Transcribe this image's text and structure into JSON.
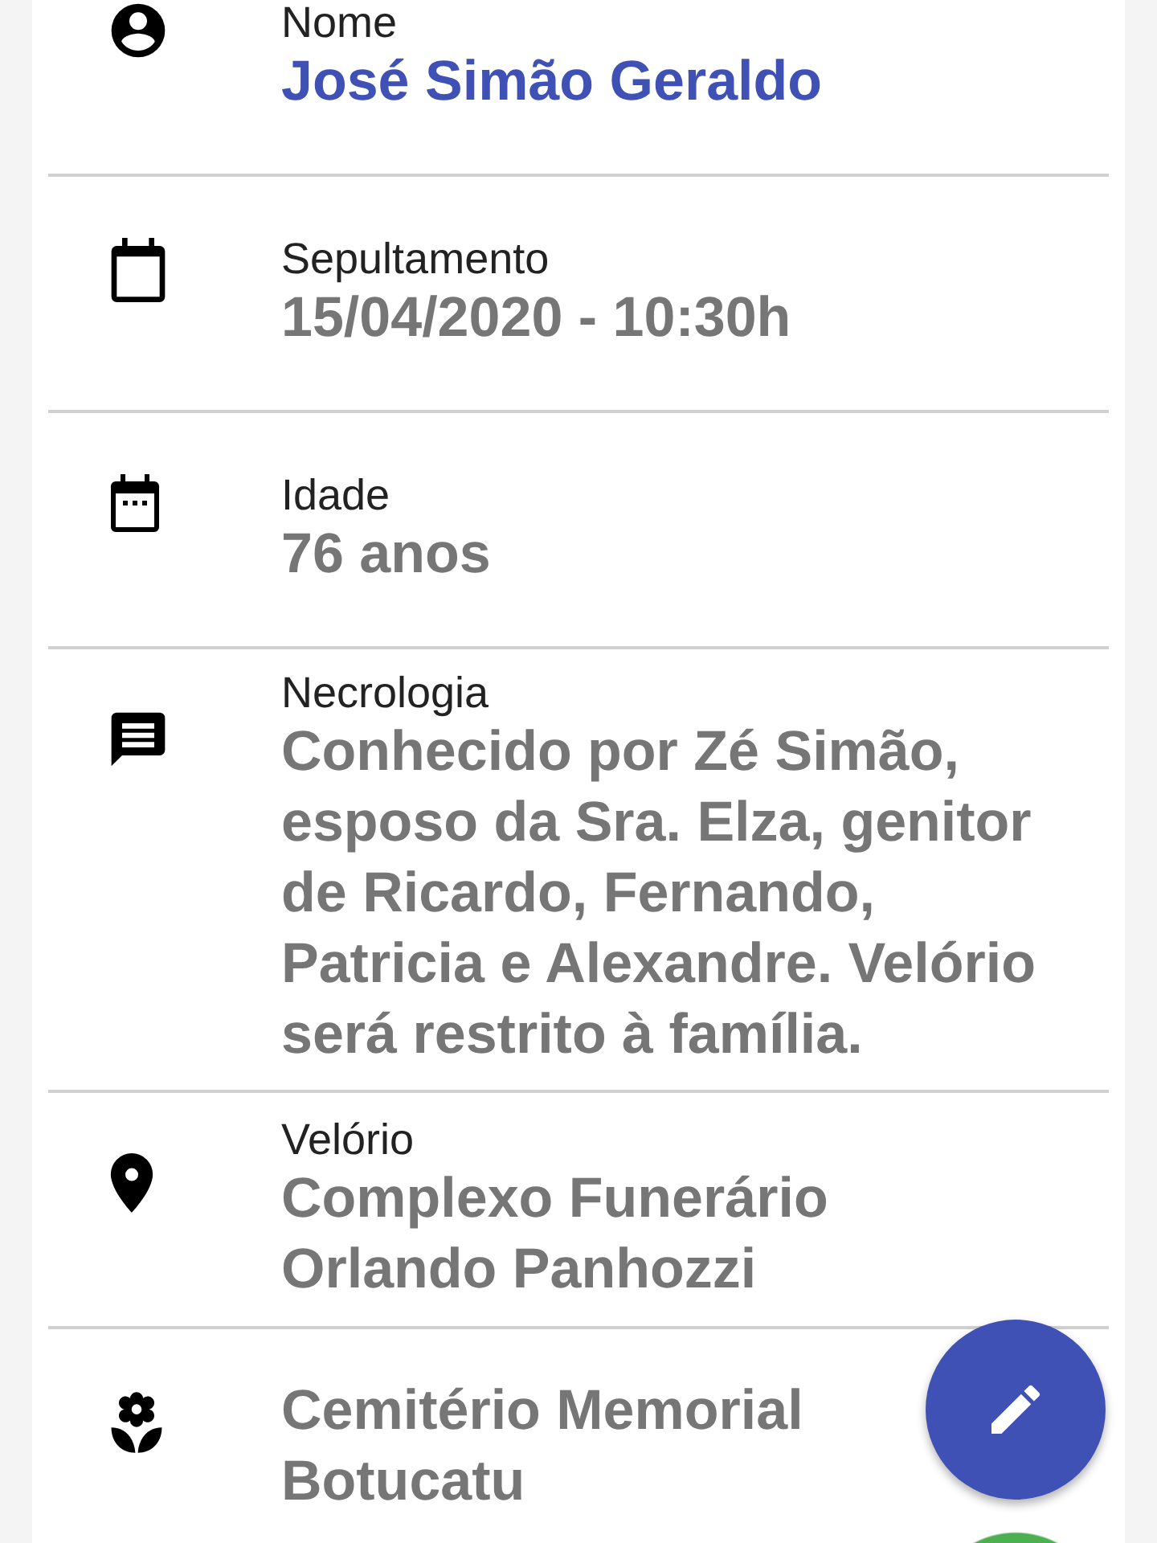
{
  "fields": [
    {
      "label": "Nome",
      "value": "José Simão Geraldo",
      "highlighted": true
    },
    {
      "label": "Sepultamento",
      "value": "15/04/2020 - 10:30h",
      "highlighted": false
    },
    {
      "label": "Idade",
      "value": "76 anos",
      "highlighted": false
    },
    {
      "label": "Necrologia",
      "value": "Conhecido por Zé Simão, esposo da Sra. Elza, genitor de Ricardo, Fernando, Patricia e Alexandre. Velório será restrito à família.",
      "highlighted": false
    },
    {
      "label": "Velório",
      "value": "Complexo Funerário Orlando Panhozzi",
      "highlighted": false
    },
    {
      "value": "Cemitério Memorial Botucatu",
      "highlighted": false
    }
  ]
}
